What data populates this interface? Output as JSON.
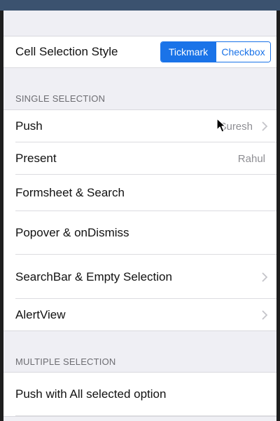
{
  "cell_selection_style": {
    "label": "Cell Selection Style",
    "segments": [
      {
        "label": "Tickmark",
        "selected": true
      },
      {
        "label": "Checkbox",
        "selected": false
      }
    ]
  },
  "single_selection": {
    "header": "SINGLE SELECTION",
    "rows": [
      {
        "label": "Push",
        "detail": "Suresh",
        "chevron": true
      },
      {
        "label": "Present",
        "detail": "Rahul",
        "chevron": false
      },
      {
        "label": "Formsheet & Search",
        "chevron": false
      },
      {
        "label": "Popover & onDismiss",
        "chevron": false
      },
      {
        "label": "SearchBar & Empty Selection",
        "chevron": true
      },
      {
        "label": "AlertView",
        "chevron": true
      }
    ]
  },
  "multiple_selection": {
    "header": "MULTIPLE SELECTION",
    "rows": [
      {
        "label": "Push with All selected option"
      }
    ]
  },
  "colors": {
    "accent": "#1a73e8",
    "background": "#efeff4",
    "status_bar": "#3b526f"
  },
  "icons": {
    "chevron": "chevron-right-icon",
    "cursor": "mouse-pointer-icon"
  }
}
